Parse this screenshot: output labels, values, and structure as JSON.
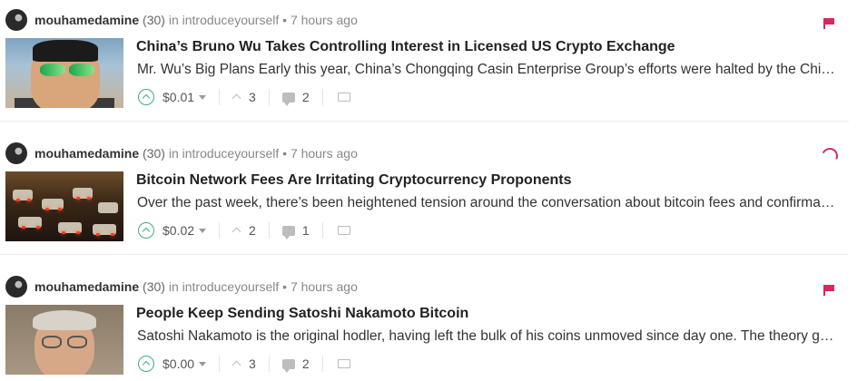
{
  "posts": [
    {
      "author": "mouhamedamine",
      "reputation": "(30)",
      "in_text": "in",
      "category": "introduceyourself",
      "separator": "•",
      "time": "7 hours ago",
      "status_icon": "flag-icon",
      "title": "China’s Bruno Wu Takes Controlling Interest in Licensed US Crypto Exchange",
      "excerpt": "Mr. Wu’s Big Plans Early this year, China’s Chongqing Casin Enterprise Group’s efforts were halted by the Chinese government",
      "payout": "$0.01",
      "votes": "3",
      "comments": "2"
    },
    {
      "author": "mouhamedamine",
      "reputation": "(30)",
      "in_text": "in",
      "category": "introduceyourself",
      "separator": "•",
      "time": "7 hours ago",
      "status_icon": "loading-spinner-icon",
      "title": "Bitcoin Network Fees Are Irritating Cryptocurrency Proponents",
      "excerpt": "Over the past week, there’s been heightened tension around the conversation about bitcoin fees and confirmation times",
      "payout": "$0.02",
      "votes": "2",
      "comments": "1"
    },
    {
      "author": "mouhamedamine",
      "reputation": "(30)",
      "in_text": "in",
      "category": "introduceyourself",
      "separator": "•",
      "time": "7 hours ago",
      "status_icon": "flag-icon",
      "title": "People Keep Sending Satoshi Nakamoto Bitcoin",
      "excerpt": "Satoshi Nakamoto is the original hodler, having left the bulk of his coins unmoved since day one. The theory goes",
      "payout": "$0.00",
      "votes": "3",
      "comments": "2"
    }
  ],
  "colors": {
    "accent": "#e0245e",
    "upvote": "#3db07c",
    "muted": "#888888"
  }
}
